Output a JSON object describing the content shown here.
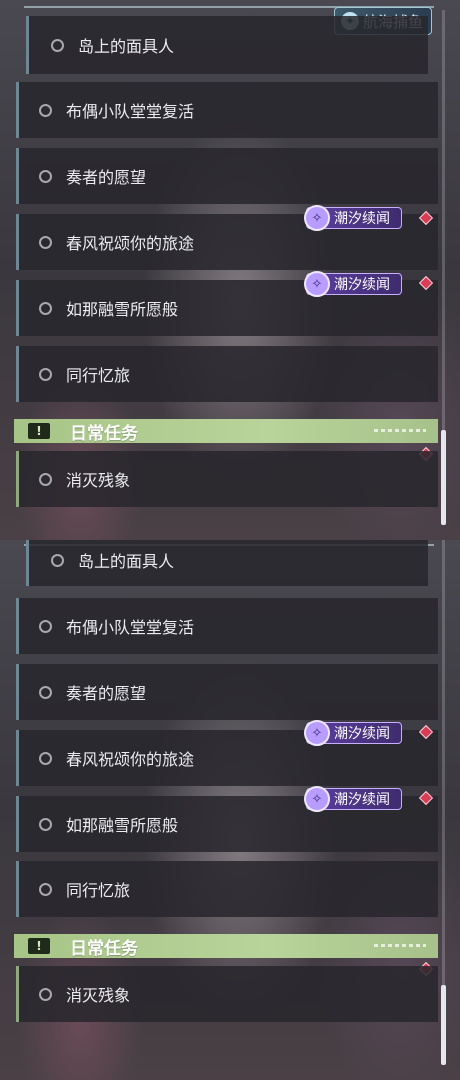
{
  "nav_badge": {
    "icon": "compass-icon",
    "label": "航海捕鱼"
  },
  "quests": [
    {
      "label": "岛上的面具人"
    },
    {
      "label": "布偶小队堂堂复活"
    },
    {
      "label": "奏者的愿望"
    },
    {
      "label": "春风祝颂你的旅途"
    },
    {
      "label": "如那融雪所愿般"
    },
    {
      "label": "同行忆旅"
    }
  ],
  "tide_tag": {
    "label": "潮汐续闻",
    "color": "#5d3fa0"
  },
  "daily_section": {
    "title": "日常任务",
    "icon": "exclamation-icon",
    "color": "#a7c487"
  },
  "daily_quests": [
    {
      "label": "消灭残象"
    }
  ],
  "colors": {
    "marker": "#d83c56",
    "scrollbar_thumb": "#e6e6ee"
  }
}
